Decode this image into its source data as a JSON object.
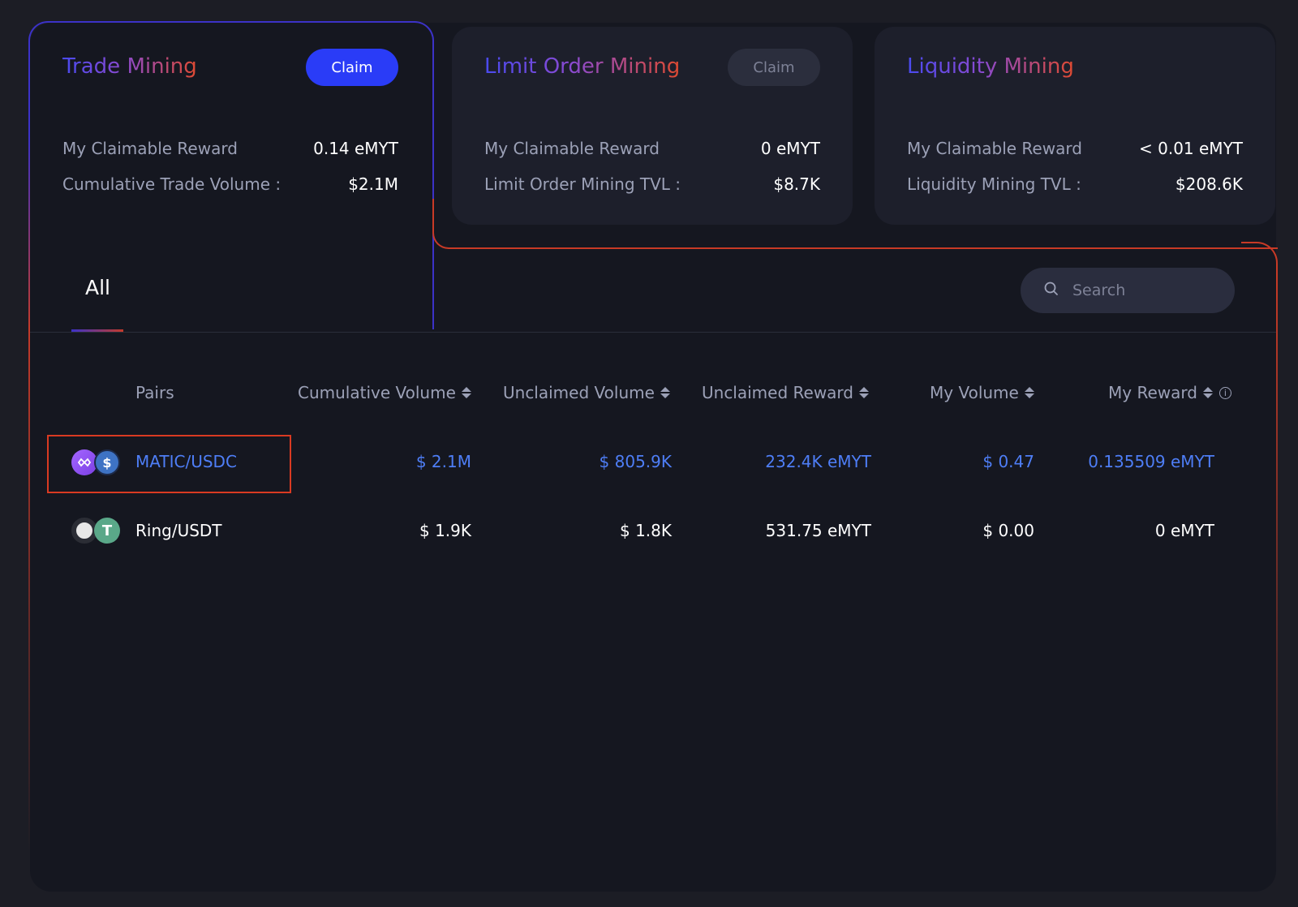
{
  "cards": [
    {
      "title": "Trade Mining",
      "claim": "Claim",
      "reward_label": "My Claimable Reward",
      "reward_value": "0.14 eMYT",
      "stat_label": "Cumulative Trade Volume :",
      "stat_value": "$2.1M"
    },
    {
      "title": "Limit Order Mining",
      "claim": "Claim",
      "reward_label": "My Claimable Reward",
      "reward_value": "0 eMYT",
      "stat_label": "Limit Order Mining TVL :",
      "stat_value": "$8.7K"
    },
    {
      "title": "Liquidity Mining",
      "reward_label": "My Claimable Reward",
      "reward_value": "< 0.01 eMYT",
      "stat_label": "Liquidity Mining TVL :",
      "stat_value": "$208.6K"
    }
  ],
  "tabs": {
    "all": "All"
  },
  "search": {
    "placeholder": "Search"
  },
  "table": {
    "headers": {
      "pairs": "Pairs",
      "cumulative_volume": "Cumulative Volume",
      "unclaimed_volume": "Unclaimed Volume",
      "unclaimed_reward": "Unclaimed Reward",
      "my_volume": "My Volume",
      "my_reward": "My Reward"
    },
    "rows": [
      {
        "pair": "MATIC/USDC",
        "cumulative_volume": "$ 2.1M",
        "unclaimed_volume": "$ 805.9K",
        "unclaimed_reward": "232.4K eMYT",
        "my_volume": "$ 0.47",
        "my_reward": "0.135509 eMYT",
        "icons": [
          "matic-icon",
          "usdc-icon"
        ]
      },
      {
        "pair": "Ring/USDT",
        "cumulative_volume": "$ 1.9K",
        "unclaimed_volume": "$ 1.8K",
        "unclaimed_reward": "531.75 eMYT",
        "my_volume": "$ 0.00",
        "my_reward": "0 eMYT",
        "icons": [
          "ring-icon",
          "usdt-icon"
        ]
      }
    ]
  },
  "colors": {
    "accent_blue": "#2a3cf7",
    "highlight_text": "#4e7ef6",
    "frame_red": "#c83a26",
    "frame_purple": "#3c32c8"
  }
}
